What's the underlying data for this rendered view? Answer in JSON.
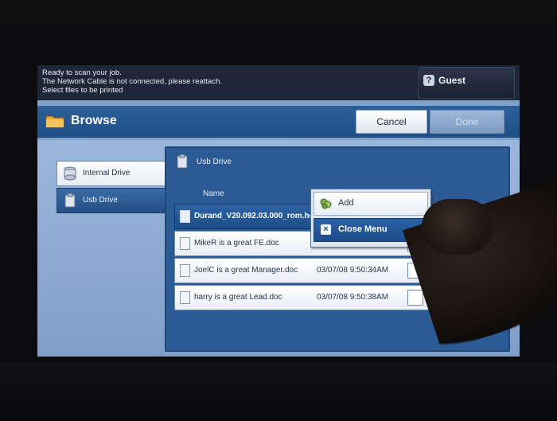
{
  "status": {
    "lines": [
      "Ready to scan your job.",
      "The Network Cable is not connected, please reattach.",
      "Select files to be printed"
    ],
    "guest_label": "Guest",
    "guest_icon": "user-question-icon"
  },
  "header": {
    "title": "Browse",
    "cancel_label": "Cancel",
    "done_label": "Done"
  },
  "sidebar": {
    "items": [
      {
        "label": "Internal Drive",
        "icon": "hard-drive-icon",
        "selected": false
      },
      {
        "label": "Usb Drive",
        "icon": "usb-drive-icon",
        "selected": true
      }
    ]
  },
  "panel": {
    "title": "Usb Drive",
    "column_name": "Name"
  },
  "files": [
    {
      "name": "Durand_V20.092.03.000_rom.hd",
      "date": "",
      "selected": true
    },
    {
      "name": "MikeR is a great FE.doc",
      "date": "",
      "selected": false
    },
    {
      "name": "JoelC is a great Manager.doc",
      "date": "03/07/08 9:50:34AM",
      "selected": false
    },
    {
      "name": "harry is a great Lead.doc",
      "date": "03/07/08 9:50:38AM",
      "selected": false
    }
  ],
  "menu": {
    "add_label": "Add",
    "close_label": "Close Menu"
  },
  "colors": {
    "header_blue": "#1f4f86",
    "selected_blue": "#1e4e8a",
    "screen_background": "#7fa0c9"
  }
}
